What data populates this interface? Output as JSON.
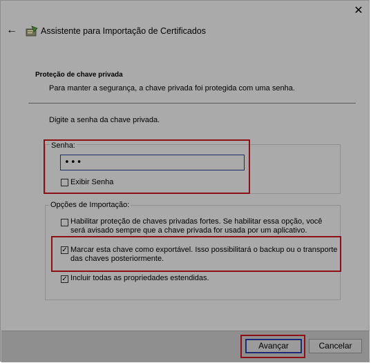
{
  "window": {
    "close_glyph": "✕",
    "back_glyph": "←",
    "title": "Assistente para Importação de Certificados"
  },
  "section": {
    "title": "Proteção de chave privada",
    "subtitle": "Para manter a segurança, a chave privada foi protegida com uma senha."
  },
  "prompt": "Digite a senha da chave privada.",
  "password": {
    "label": "Senha:",
    "value": "•••",
    "show_label": "Exibir Senha",
    "show_checked": false
  },
  "options": {
    "label": "Opções de Importação:",
    "items": [
      {
        "text": "Habilitar proteção de chaves privadas fortes. Se habilitar essa opção, você será avisado sempre que a chave privada for usada por um aplicativo.",
        "checked": false,
        "mark": ""
      },
      {
        "text": "Marcar esta chave como exportável. Isso possibilitará o backup ou o transporte das chaves posteriormente.",
        "checked": true,
        "mark": "✓"
      },
      {
        "text": "Incluir todas as propriedades estendidas.",
        "checked": true,
        "mark": "✓"
      }
    ]
  },
  "footer": {
    "next_label": "Avançar",
    "cancel_label": "Cancelar"
  },
  "colors": {
    "overlay_gray": "#aaaaaa",
    "highlight_red": "#8b0f14",
    "focus_blue": "#1c2a78"
  }
}
